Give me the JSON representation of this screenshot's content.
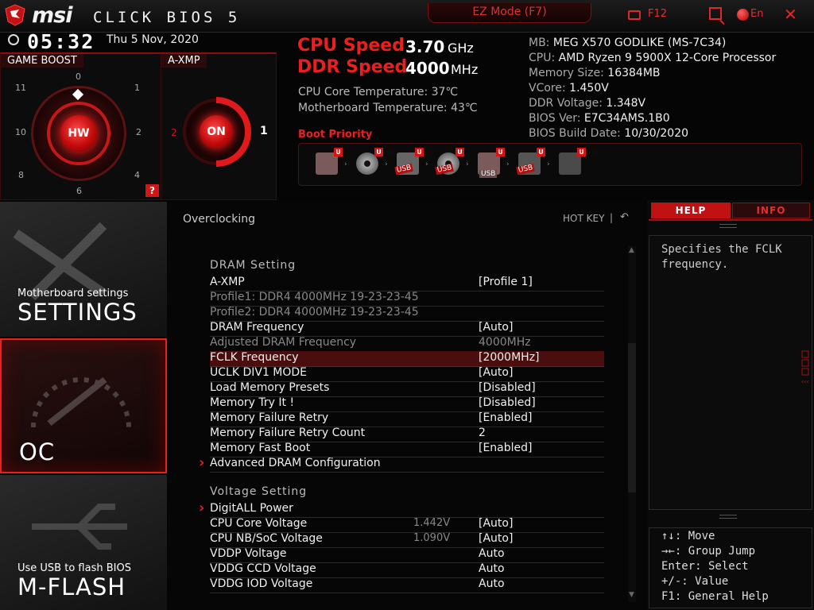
{
  "header": {
    "brand": "msi",
    "product": "CLICK BIOS 5",
    "ez_mode": "EZ Mode (F7)",
    "screenshot_key": "F12",
    "language": "En",
    "close": "✕"
  },
  "clock": {
    "time": "05:32",
    "date": "Thu  5 Nov, 2020"
  },
  "game_boost": {
    "label": "GAME BOOST",
    "button": "HW",
    "dial_numbers": [
      "0",
      "1",
      "2",
      "4",
      "6",
      "8",
      "10",
      "11"
    ],
    "help": "?"
  },
  "axmp": {
    "label": "A-XMP",
    "button": "ON",
    "left_profile": "2",
    "right_profile": "1"
  },
  "speeds": {
    "cpu_label": "CPU Speed",
    "cpu_value": "3.70",
    "cpu_unit": "GHz",
    "ddr_label": "DDR Speed",
    "ddr_value": "4000",
    "ddr_unit": "MHz"
  },
  "temps": [
    "CPU Core Temperature: 37℃",
    "Motherboard Temperature: 43℃"
  ],
  "system_info": [
    {
      "label": "MB: ",
      "value": "MEG X570 GODLIKE (MS-7C34)"
    },
    {
      "label": "CPU: ",
      "value": "AMD Ryzen 9 5900X 12-Core Processor"
    },
    {
      "label": "Memory Size: ",
      "value": "16384MB"
    },
    {
      "label": "VCore: ",
      "value": "1.450V"
    },
    {
      "label": "DDR Voltage: ",
      "value": "1.348V"
    },
    {
      "label": "BIOS Ver: ",
      "value": "E7C34AMS.1B0"
    },
    {
      "label": "BIOS Build Date: ",
      "value": "10/30/2020"
    }
  ],
  "boot_priority": {
    "title": "Boot Priority",
    "badge": "U",
    "usb_tag": "USB",
    "devices": [
      "hdd-icon",
      "optical-disc-icon",
      "usb-disk-icon",
      "usb-optical-icon",
      "usb-key-icon",
      "usb-floppy-icon",
      "network-icon"
    ]
  },
  "nav": {
    "settings_sub": "Motherboard settings",
    "settings": "SETTINGS",
    "oc": "OC",
    "mflash_sub": "Use USB to flash BIOS",
    "mflash": "M-FLASH"
  },
  "main": {
    "breadcrumb": "Overclocking",
    "hotkey": "HOT KEY",
    "hotkey_sep": "|",
    "back": "↶",
    "dram_title": "DRAM  Setting",
    "voltage_title": "Voltage  Setting",
    "dram_rows": [
      {
        "name": "A-XMP",
        "cur": "",
        "value": "[Profile 1]"
      },
      {
        "name": "Profile1: DDR4 4000MHz 19-23-23-45",
        "cur": "",
        "value": ""
      },
      {
        "name": "Profile2: DDR4 4000MHz 19-23-23-45",
        "cur": "",
        "value": ""
      },
      {
        "name": "DRAM Frequency",
        "cur": "",
        "value": "[Auto]"
      },
      {
        "name": "Adjusted DRAM Frequency",
        "cur": "",
        "value": "4000MHz"
      },
      {
        "name": "FCLK Frequency",
        "cur": "",
        "value": "[2000MHz]"
      },
      {
        "name": "UCLK DIV1 MODE",
        "cur": "",
        "value": "[Auto]"
      },
      {
        "name": "Load Memory Presets",
        "cur": "",
        "value": "[Disabled]"
      },
      {
        "name": "Memory Try It !",
        "cur": "",
        "value": "[Disabled]"
      },
      {
        "name": "Memory Failure Retry",
        "cur": "",
        "value": "[Enabled]"
      },
      {
        "name": "Memory Failure Retry Count",
        "cur": "",
        "value": "2"
      },
      {
        "name": "Memory Fast Boot",
        "cur": "",
        "value": "[Enabled]"
      },
      {
        "name": "Advanced DRAM Configuration",
        "cur": "",
        "value": ""
      }
    ],
    "voltage_rows": [
      {
        "name": "DigitALL Power",
        "cur": "",
        "value": ""
      },
      {
        "name": "CPU Core Voltage",
        "cur": "1.442V",
        "value": "[Auto]"
      },
      {
        "name": "CPU NB/SoC Voltage",
        "cur": "1.090V",
        "value": "[Auto]"
      },
      {
        "name": "VDDP Voltage",
        "cur": "",
        "value": "Auto"
      },
      {
        "name": "VDDG CCD Voltage",
        "cur": "",
        "value": "Auto"
      },
      {
        "name": "VDDG IOD Voltage",
        "cur": "",
        "value": "Auto"
      }
    ]
  },
  "help": {
    "tab_help": "HELP",
    "tab_info": "INFO",
    "text": "Specifies the FCLK frequency.",
    "keys": [
      "↑↓: Move",
      "→←: Group Jump",
      "Enter: Select",
      "+/-: Value",
      "F1: General Help"
    ]
  },
  "colors": {
    "accent": "#e8201f",
    "selected_row": "#4a0e0e",
    "background": "#050505"
  }
}
